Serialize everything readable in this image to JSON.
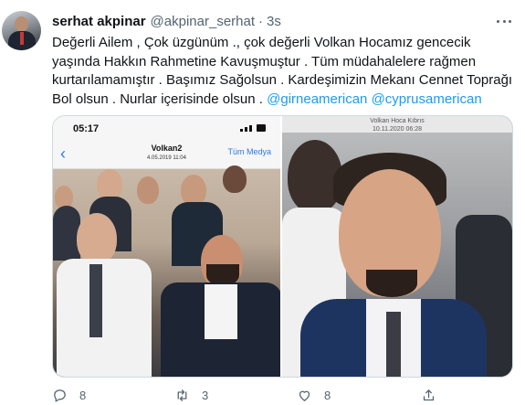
{
  "tweet": {
    "author_name": "serhat akpinar",
    "handle": "@akpinar_serhat",
    "separator": "·",
    "time": "3s",
    "text_lines": [
      "Değerli Ailem , Çok üzgünüm ., çok değerli Volkan Hocamız gencecik",
      "yaşında Hakkın Rahmetine Kavuşmuştur . Tüm müdahalelere rağmen",
      "kurtarılamamıştır . Başımız Sağolsun . Kardeşimizin Mekanı Cennet Toprağı",
      "Bol olsun . Nurlar içerisinde olsun ."
    ],
    "mentions": [
      "@girneamerican",
      "@cyprusamerican"
    ]
  },
  "media": {
    "left": {
      "phone_time": "05:17",
      "title": "Volkan2",
      "subtitle": "4.05.2019 11:04",
      "media_link": "Tüm Medya"
    },
    "right": {
      "caption_title": "Volkan Hoca Kıbrıs",
      "caption_date": "10.11.2020 06:28"
    }
  },
  "actions": {
    "reply_count": "8",
    "retweet_count": "3",
    "like_count": "8"
  },
  "icons": {
    "reply": "reply-icon",
    "retweet": "retweet-icon",
    "like": "heart-icon",
    "share": "share-icon",
    "more": "more-icon"
  },
  "colors": {
    "link": "#1d9bf0",
    "secondary_text": "#536471",
    "primary_text": "#0f1419"
  }
}
